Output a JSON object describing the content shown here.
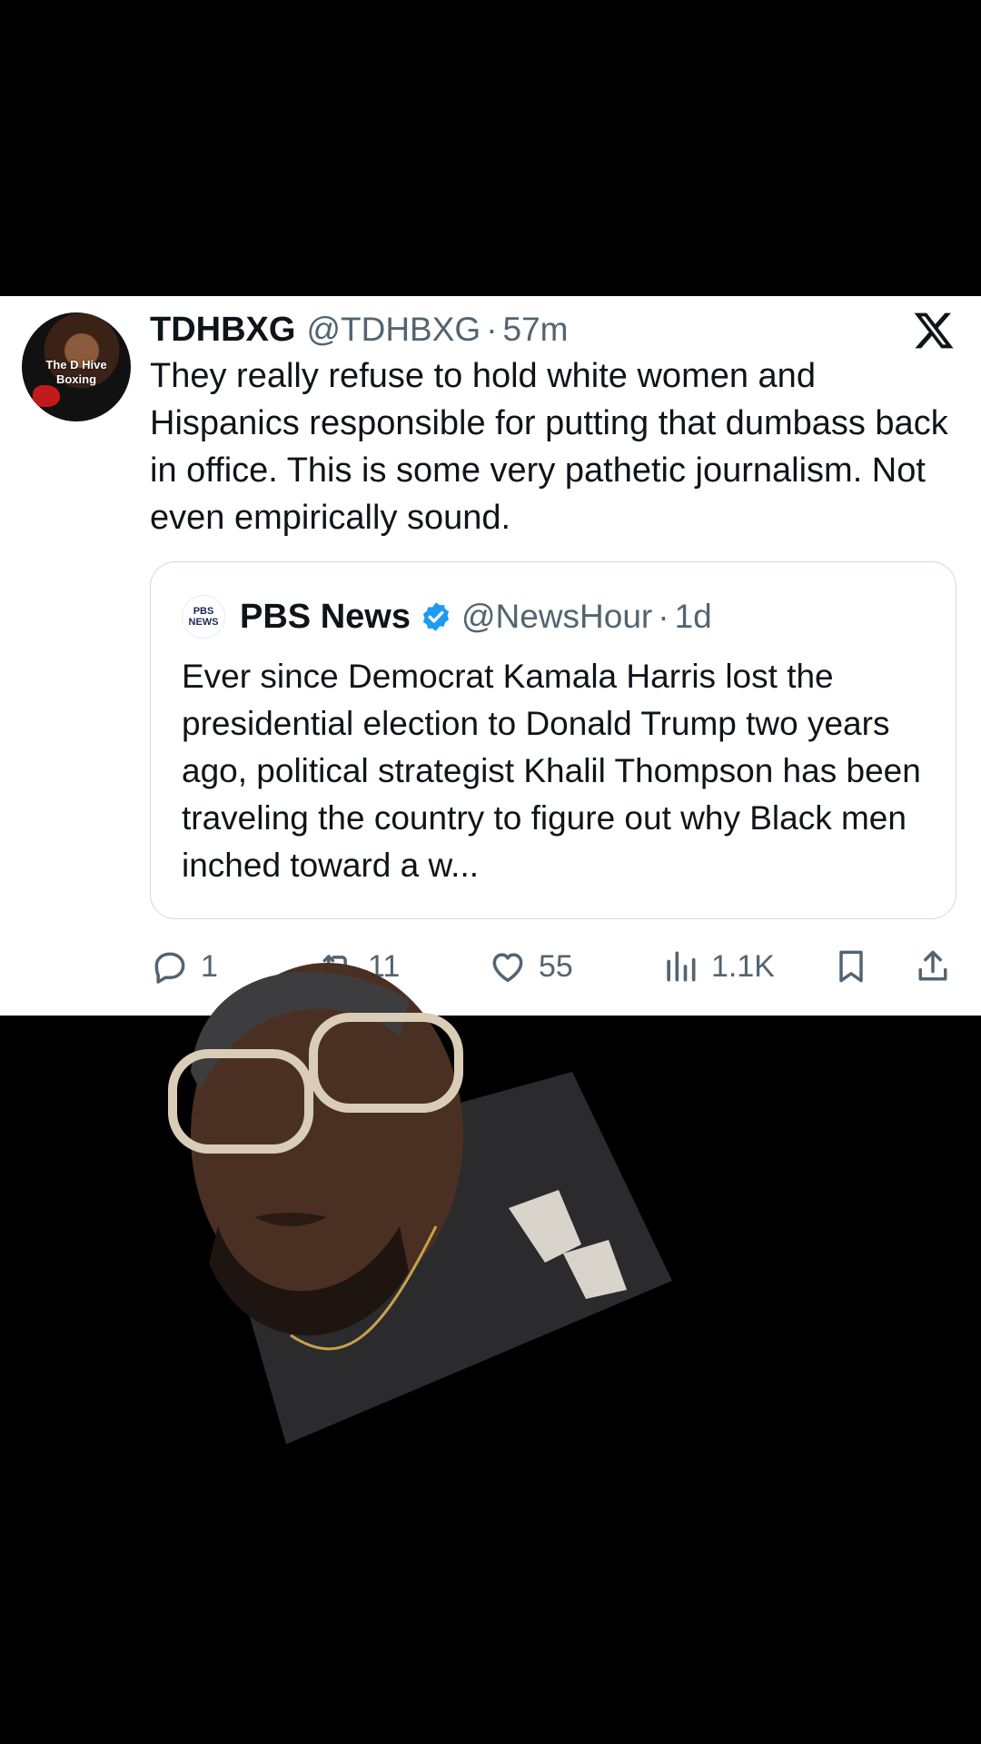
{
  "tweet": {
    "author_name": "TDHBXG",
    "author_handle": "@TDHBXG",
    "separator": "·",
    "time": "57m",
    "avatar_text": [
      "The D Hive",
      "Boxing"
    ],
    "text": "They really refuse to hold white women and Hispanics responsible for putting that dumbass back in office. This is some very pathetic journalism. Not even empirically sound.",
    "platform_logo": "x-logo-icon"
  },
  "quoted_tweet": {
    "logo_text": [
      "PBS",
      "NEWS"
    ],
    "author_name": "PBS News",
    "verified": true,
    "author_handle": "@NewsHour",
    "separator": "·",
    "time": "1d",
    "text": "Ever since Democrat Kamala Harris lost the presidential election to Donald Trump two years ago, political strategist Khalil Thompson has been traveling the country to figure out why Black men inched toward a w..."
  },
  "actions": {
    "replies": "1",
    "reposts": "11",
    "likes": "55",
    "views": "1.1K"
  },
  "colors": {
    "text_primary": "#0f1419",
    "text_secondary": "#536471",
    "verified": "#1d9bf0",
    "background": "#000000",
    "card": "#ffffff"
  }
}
